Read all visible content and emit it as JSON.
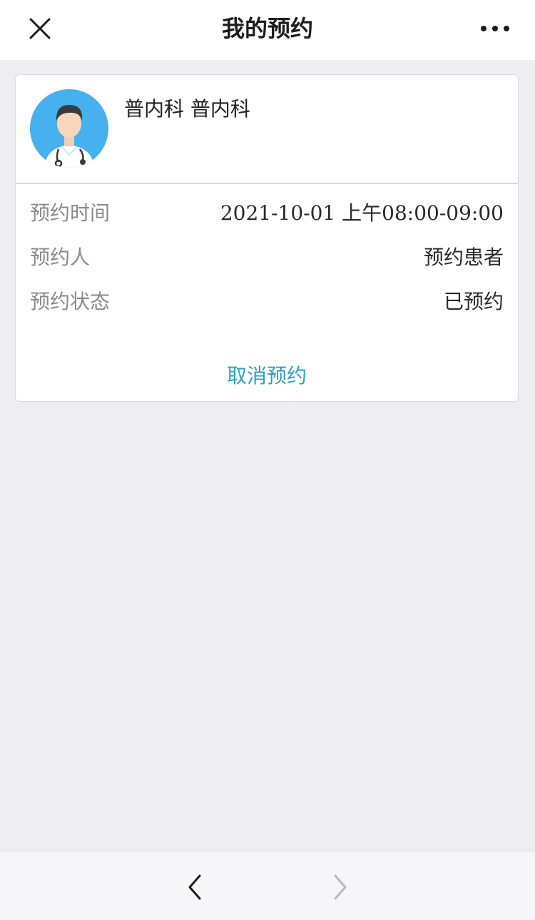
{
  "nav": {
    "title": "我的预约",
    "close_icon": "close-icon",
    "more_icon": "more-icon"
  },
  "appointment": {
    "avatar_icon": "doctor-avatar-icon",
    "department": "普内科 普内科",
    "details": [
      {
        "label": "预约时间",
        "value": "2021-10-01 上午08:00-09:00"
      },
      {
        "label": "预约人",
        "value": "预约患者"
      },
      {
        "label": "预约状态",
        "value": "已预约"
      }
    ],
    "cancel_label": "取消预约"
  },
  "toolbar": {
    "back_icon": "chevron-left-icon",
    "forward_icon": "chevron-right-icon"
  },
  "colors": {
    "background": "#ededf2",
    "accent": "#2a9fc4",
    "avatar_bg": "#46b1ee"
  }
}
